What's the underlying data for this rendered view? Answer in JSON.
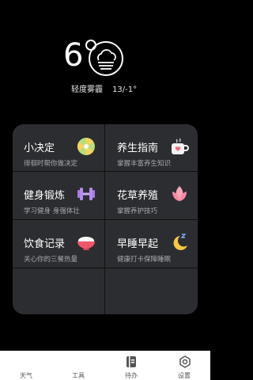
{
  "weather": {
    "temperature": "6",
    "condition": "轻度雾霾",
    "range": "13/-1°",
    "icon": "haze-cloud-icon"
  },
  "tools": [
    {
      "title": "小决定",
      "subtitle": "徘徊时帮你做决定",
      "icon": "pie-wheel-icon"
    },
    {
      "title": "养生指南",
      "subtitle": "掌握丰富养生知识",
      "icon": "tea-cup-icon"
    },
    {
      "title": "健身锻炼",
      "subtitle": "学习健身 身强体壮",
      "icon": "dumbbell-icon"
    },
    {
      "title": "花草养殖",
      "subtitle": "掌握养护技巧",
      "icon": "lotus-icon"
    },
    {
      "title": "饮食记录",
      "subtitle": "关心你的三餐热量",
      "icon": "rice-bowl-icon"
    },
    {
      "title": "早睡早起",
      "subtitle": "健康打卡保障睡眠",
      "icon": "moon-sleep-icon"
    }
  ],
  "tabs": [
    {
      "label": "天气",
      "icon": "none",
      "active": false
    },
    {
      "label": "工具",
      "icon": "none",
      "active": true
    },
    {
      "label": "待办",
      "icon": "notebook-icon",
      "active": false
    },
    {
      "label": "设置",
      "icon": "hexagon-settings-icon",
      "active": false
    }
  ],
  "colors": {
    "background": "#000000",
    "card": "#2c2d30",
    "tabbar": "#ffffff"
  }
}
